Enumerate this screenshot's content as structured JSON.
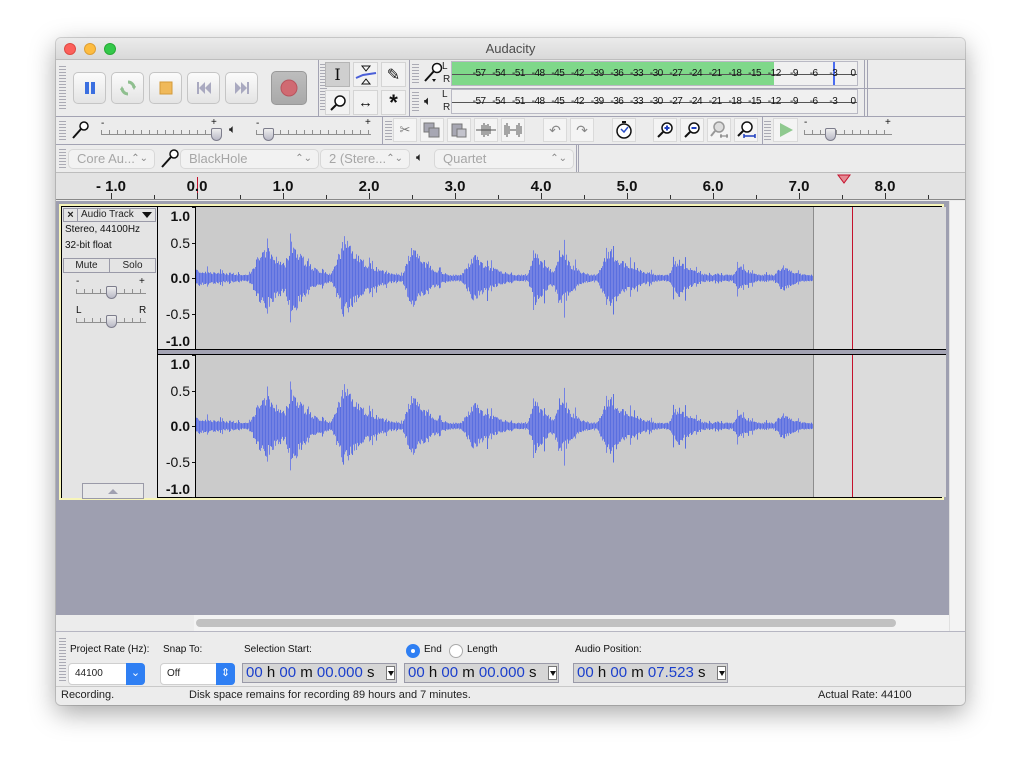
{
  "window": {
    "title": "Audacity"
  },
  "transport": {
    "buttons": [
      {
        "name": "pause-button",
        "icon": "pause-icon"
      },
      {
        "name": "loop-button",
        "icon": "loop-icon"
      },
      {
        "name": "stop-button",
        "icon": "stop-icon"
      },
      {
        "name": "skip-start-button",
        "icon": "skip-start-icon"
      },
      {
        "name": "skip-end-button",
        "icon": "skip-end-icon"
      },
      {
        "name": "record-button",
        "icon": "record-icon"
      }
    ],
    "colors": {
      "pause": "#3b6fe0",
      "loop": "#8fbf8f",
      "stop": "#f0b95a",
      "record": "#d06a72",
      "skip": "#a9a9c0"
    }
  },
  "tools": [
    {
      "name": "selection-tool",
      "icon": "ibeam-icon",
      "active": true
    },
    {
      "name": "envelope-tool",
      "icon": "envelope-icon",
      "active": false
    },
    {
      "name": "draw-tool",
      "icon": "pencil-icon",
      "active": false
    },
    {
      "name": "zoom-tool",
      "icon": "magnifier-icon",
      "active": false
    },
    {
      "name": "timeshift-tool",
      "icon": "double-arrow-icon",
      "active": false
    },
    {
      "name": "multi-tool",
      "icon": "asterisk-icon",
      "active": false
    }
  ],
  "meters": {
    "record": {
      "channels": [
        "L",
        "R"
      ],
      "ticks": [
        "-57",
        "-54",
        "-51",
        "-48",
        "-45",
        "-42",
        "-39",
        "-36",
        "-33",
        "-30",
        "-27",
        "-24",
        "-21",
        "-18",
        "-15",
        "-12",
        "-9",
        "-6",
        "-3",
        "0"
      ],
      "level_db": -12,
      "peak_db": -3,
      "fill_color": "#7fd88a"
    },
    "playback": {
      "channels": [
        "L",
        "R"
      ],
      "ticks": [
        "-57",
        "-54",
        "-51",
        "-48",
        "-45",
        "-42",
        "-39",
        "-36",
        "-33",
        "-30",
        "-27",
        "-24",
        "-21",
        "-18",
        "-15",
        "-12",
        "-9",
        "-6",
        "-3",
        "0"
      ]
    }
  },
  "mixer": {
    "record_volume": {
      "min_label": "-",
      "max_label": "+",
      "value": 1.0
    },
    "playback_volume": {
      "min_label": "-",
      "max_label": "+",
      "value": 0.1
    }
  },
  "edit_toolbar": [
    {
      "name": "cut-button",
      "icon": "scissors-icon"
    },
    {
      "name": "copy-button",
      "icon": "copy-icon"
    },
    {
      "name": "paste-button",
      "icon": "paste-icon"
    },
    {
      "name": "trim-button",
      "icon": "trim-icon"
    },
    {
      "name": "silence-button",
      "icon": "silence-icon"
    },
    {
      "name": "undo-button",
      "icon": "undo-icon"
    },
    {
      "name": "redo-button",
      "icon": "redo-icon"
    },
    {
      "name": "sync-lock-button",
      "icon": "stopwatch-icon"
    },
    {
      "name": "zoom-in-button",
      "icon": "zoom-in-icon"
    },
    {
      "name": "zoom-out-button",
      "icon": "zoom-out-icon"
    },
    {
      "name": "fit-selection-button",
      "icon": "zoom-selection-icon"
    },
    {
      "name": "fit-project-button",
      "icon": "zoom-fit-icon"
    }
  ],
  "play_at_speed": {
    "min_label": "-",
    "max_label": "+",
    "value": 0.3
  },
  "device": {
    "host": "Core Au...",
    "input_device": "BlackHole",
    "channels": "2 (Stere...",
    "output_device": "Quartet"
  },
  "ruler": {
    "labels": [
      "- 1.0",
      "0.0",
      "1.0",
      "2.0",
      "3.0",
      "4.0",
      "5.0",
      "6.0",
      "7.0",
      "8.0"
    ],
    "values": [
      -1,
      0,
      1,
      2,
      3,
      4,
      5,
      6,
      7,
      8
    ],
    "playhead_seconds": 7.523
  },
  "track": {
    "name": "Audio Track",
    "info_line1": "Stereo, 44100Hz",
    "info_line2": "32-bit float",
    "mute_label": "Mute",
    "solo_label": "Solo",
    "gain": {
      "min_label": "-",
      "max_label": "+",
      "value": 0.5
    },
    "pan": {
      "min_label": "L",
      "max_label": "R",
      "value": 0.5
    },
    "amp_labels": [
      "1.0",
      "0.5",
      "0.0",
      "-0.5",
      "-1.0"
    ],
    "clip_end_seconds": 7.15,
    "wave_color": "#5a6fe0"
  },
  "selection_bar": {
    "project_rate_label": "Project Rate (Hz):",
    "project_rate": "44100",
    "snap_label": "Snap To:",
    "snap_value": "Off",
    "selection_start_label": "Selection Start:",
    "end_label": "End",
    "length_label": "Length",
    "end_selected": true,
    "audio_position_label": "Audio Position:",
    "selection_start": {
      "h": "00",
      "m": "00",
      "s": "00.000"
    },
    "selection_end": {
      "h": "00",
      "m": "00",
      "s": "00.000"
    },
    "audio_position": {
      "h": "00",
      "m": "00",
      "s": "07.523"
    },
    "h_unit": "h",
    "m_unit": "m",
    "s_unit": "s"
  },
  "status": {
    "left": "Recording.",
    "middle": "Disk space remains for recording 89 hours and 7 minutes.",
    "right": "Actual Rate: 44100"
  }
}
